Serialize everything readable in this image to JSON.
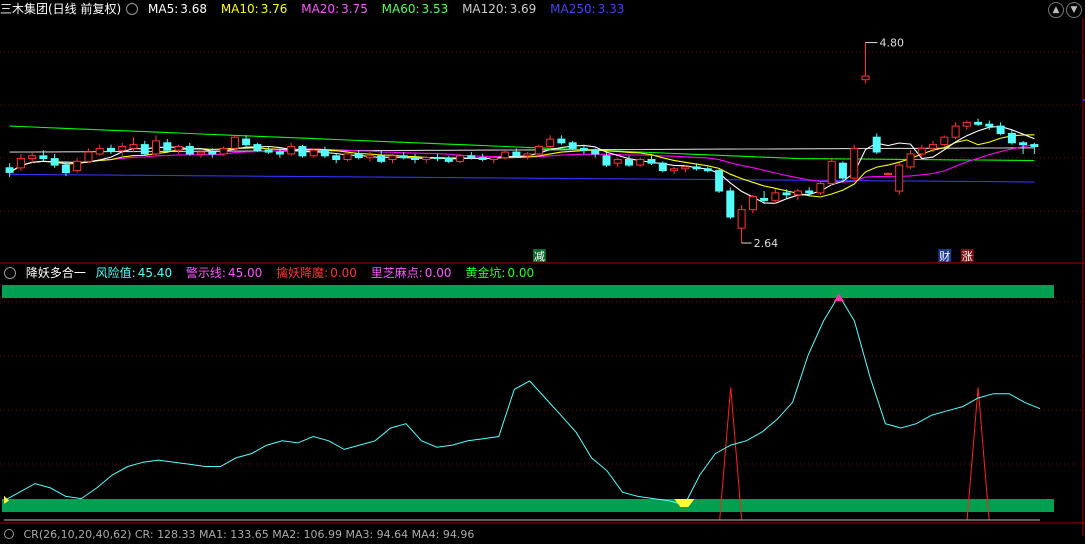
{
  "main_header": {
    "title": "三木集团(日线 前复权)",
    "items": [
      {
        "label": "MA5:",
        "value": "3.68",
        "color": "#ffffff"
      },
      {
        "label": "MA10:",
        "value": "3.76",
        "color": "#ffff00"
      },
      {
        "label": "MA20:",
        "value": "3.75",
        "color": "#ff00ff"
      },
      {
        "label": "MA60:",
        "value": "3.53",
        "color": "#00ff00"
      },
      {
        "label": "MA120:",
        "value": "3.69",
        "color": "#cccccc"
      },
      {
        "label": "MA250:",
        "value": "3.33",
        "color": "#3333ff"
      }
    ]
  },
  "indicator_header": {
    "title": "降妖多合一",
    "items": [
      {
        "label": "风险值:",
        "value": "45.40",
        "color": "#55ffff"
      },
      {
        "label": "警示线:",
        "value": "45.00",
        "color": "#ff55ff"
      },
      {
        "label": "擒妖降魔:",
        "value": "0.00",
        "color": "#ff3333"
      },
      {
        "label": "里芝麻点:",
        "value": "0.00",
        "color": "#ff55ff"
      },
      {
        "label": "黄金坑:",
        "value": "0.00",
        "color": "#00ff00"
      }
    ]
  },
  "bottom_header": {
    "text": "CR(26,10,20,40,62)  CR: 128.33  MA1: 133.65  MA2: 106.99  MA3: 94.64  MA4: 94.96"
  },
  "markers": {
    "high_label": "4.80",
    "low_label": "2.64",
    "tag_jian": "减",
    "tag_cai": "财",
    "tag_zhang": "涨"
  },
  "colors": {
    "up": "#ff3333",
    "down": "#54fcfc",
    "ma5": "#ffffff",
    "ma10": "#ffff00",
    "ma20": "#ff00ff",
    "ma60": "#00ff00",
    "ma120": "#cccccc",
    "ma250": "#3333ff",
    "band": "#00a050",
    "risk_line": "#55ffff",
    "signal": "#ff2020"
  },
  "chart_data": [
    {
      "type": "candlestick",
      "title": "三木集团(日线 前复权)",
      "ylim": [
        2.5,
        5.0
      ],
      "annotations": [
        {
          "text": "4.80",
          "y": 4.8
        },
        {
          "text": "2.64",
          "y": 2.64
        }
      ],
      "candles": [
        [
          3.45,
          3.5,
          3.35,
          3.4
        ],
        [
          3.45,
          3.6,
          3.42,
          3.55
        ],
        [
          3.55,
          3.62,
          3.5,
          3.58
        ],
        [
          3.58,
          3.64,
          3.52,
          3.55
        ],
        [
          3.55,
          3.6,
          3.45,
          3.48
        ],
        [
          3.48,
          3.52,
          3.36,
          3.4
        ],
        [
          3.42,
          3.55,
          3.4,
          3.52
        ],
        [
          3.52,
          3.66,
          3.5,
          3.62
        ],
        [
          3.6,
          3.7,
          3.58,
          3.66
        ],
        [
          3.66,
          3.7,
          3.6,
          3.63
        ],
        [
          3.64,
          3.72,
          3.58,
          3.68
        ],
        [
          3.66,
          3.78,
          3.62,
          3.7
        ],
        [
          3.7,
          3.74,
          3.58,
          3.6
        ],
        [
          3.6,
          3.8,
          3.58,
          3.74
        ],
        [
          3.72,
          3.76,
          3.62,
          3.64
        ],
        [
          3.64,
          3.7,
          3.6,
          3.68
        ],
        [
          3.68,
          3.72,
          3.58,
          3.6
        ],
        [
          3.6,
          3.64,
          3.56,
          3.62
        ],
        [
          3.62,
          3.66,
          3.56,
          3.6
        ],
        [
          3.6,
          3.68,
          3.58,
          3.66
        ],
        [
          3.66,
          3.8,
          3.64,
          3.78
        ],
        [
          3.76,
          3.8,
          3.66,
          3.7
        ],
        [
          3.7,
          3.72,
          3.62,
          3.64
        ],
        [
          3.64,
          3.68,
          3.6,
          3.62
        ],
        [
          3.62,
          3.66,
          3.56,
          3.6
        ],
        [
          3.6,
          3.72,
          3.58,
          3.68
        ],
        [
          3.68,
          3.7,
          3.56,
          3.58
        ],
        [
          3.58,
          3.66,
          3.56,
          3.64
        ],
        [
          3.64,
          3.68,
          3.56,
          3.58
        ],
        [
          3.58,
          3.6,
          3.5,
          3.54
        ],
        [
          3.54,
          3.62,
          3.52,
          3.6
        ],
        [
          3.6,
          3.64,
          3.54,
          3.56
        ],
        [
          3.56,
          3.62,
          3.52,
          3.58
        ],
        [
          3.58,
          3.64,
          3.5,
          3.52
        ],
        [
          3.54,
          3.6,
          3.5,
          3.58
        ],
        [
          3.58,
          3.62,
          3.54,
          3.56
        ],
        [
          3.56,
          3.6,
          3.5,
          3.54
        ],
        [
          3.54,
          3.58,
          3.5,
          3.56
        ],
        [
          3.56,
          3.6,
          3.52,
          3.55
        ],
        [
          3.55,
          3.58,
          3.5,
          3.52
        ],
        [
          3.52,
          3.6,
          3.5,
          3.58
        ],
        [
          3.58,
          3.62,
          3.54,
          3.56
        ],
        [
          3.56,
          3.6,
          3.52,
          3.54
        ],
        [
          3.54,
          3.58,
          3.5,
          3.56
        ],
        [
          3.56,
          3.64,
          3.54,
          3.62
        ],
        [
          3.62,
          3.66,
          3.56,
          3.58
        ],
        [
          3.58,
          3.62,
          3.54,
          3.6
        ],
        [
          3.6,
          3.7,
          3.58,
          3.68
        ],
        [
          3.68,
          3.8,
          3.64,
          3.76
        ],
        [
          3.76,
          3.8,
          3.7,
          3.72
        ],
        [
          3.72,
          3.74,
          3.64,
          3.66
        ],
        [
          3.66,
          3.7,
          3.6,
          3.64
        ],
        [
          3.64,
          3.66,
          3.56,
          3.6
        ],
        [
          3.58,
          3.62,
          3.46,
          3.48
        ],
        [
          3.5,
          3.56,
          3.46,
          3.54
        ],
        [
          3.54,
          3.58,
          3.46,
          3.48
        ],
        [
          3.48,
          3.56,
          3.46,
          3.54
        ],
        [
          3.54,
          3.58,
          3.48,
          3.5
        ],
        [
          3.5,
          3.52,
          3.4,
          3.42
        ],
        [
          3.42,
          3.46,
          3.38,
          3.44
        ],
        [
          3.44,
          3.48,
          3.4,
          3.46
        ],
        [
          3.46,
          3.5,
          3.42,
          3.44
        ],
        [
          3.44,
          3.46,
          3.4,
          3.42
        ],
        [
          3.42,
          3.44,
          3.18,
          3.2
        ],
        [
          3.2,
          3.24,
          2.9,
          2.92
        ],
        [
          2.8,
          3.05,
          2.64,
          3.0
        ],
        [
          3.0,
          3.16,
          2.96,
          3.14
        ],
        [
          3.12,
          3.2,
          3.06,
          3.1
        ],
        [
          3.1,
          3.22,
          3.06,
          3.18
        ],
        [
          3.18,
          3.22,
          3.12,
          3.16
        ],
        [
          3.16,
          3.22,
          3.1,
          3.2
        ],
        [
          3.2,
          3.24,
          3.14,
          3.18
        ],
        [
          3.18,
          3.3,
          3.16,
          3.28
        ],
        [
          3.28,
          3.56,
          3.26,
          3.52
        ],
        [
          3.5,
          3.52,
          3.3,
          3.34
        ],
        [
          3.34,
          3.7,
          3.32,
          3.66
        ],
        [
          4.4,
          4.8,
          4.36,
          4.44
        ],
        [
          3.78,
          3.82,
          3.6,
          3.62
        ],
        [
          3.38,
          3.4,
          3.38,
          3.39
        ],
        [
          3.2,
          3.5,
          3.16,
          3.48
        ],
        [
          3.46,
          3.64,
          3.44,
          3.6
        ],
        [
          3.6,
          3.7,
          3.56,
          3.66
        ],
        [
          3.66,
          3.74,
          3.62,
          3.7
        ],
        [
          3.7,
          3.8,
          3.68,
          3.78
        ],
        [
          3.78,
          3.94,
          3.76,
          3.9
        ],
        [
          3.9,
          3.96,
          3.86,
          3.94
        ],
        [
          3.94,
          3.98,
          3.9,
          3.92
        ],
        [
          3.92,
          3.96,
          3.86,
          3.9
        ],
        [
          3.9,
          3.94,
          3.8,
          3.82
        ],
        [
          3.82,
          3.86,
          3.7,
          3.72
        ],
        [
          3.72,
          3.74,
          3.6,
          3.7
        ],
        [
          3.7,
          3.72,
          3.6,
          3.68
        ]
      ],
      "series": [
        {
          "name": "MA5",
          "value": "3.68"
        },
        {
          "name": "MA10",
          "value": "3.76"
        },
        {
          "name": "MA20",
          "value": "3.75"
        },
        {
          "name": "MA60",
          "value": "3.53"
        },
        {
          "name": "MA120",
          "value": "3.69"
        },
        {
          "name": "MA250",
          "value": "3.33"
        }
      ]
    },
    {
      "type": "line",
      "title": "降妖多合一",
      "ylim": [
        0,
        100
      ],
      "series": [
        {
          "name": "风险值",
          "values": [
            2,
            6,
            10,
            8,
            4,
            3,
            8,
            14,
            18,
            20,
            21,
            20,
            19,
            18,
            18,
            22,
            24,
            28,
            30,
            29,
            32,
            30,
            26,
            28,
            30,
            36,
            38,
            30,
            27,
            28,
            30,
            31,
            32,
            54,
            58,
            50,
            42,
            34,
            22,
            16,
            6,
            4,
            3,
            2,
            0,
            14,
            24,
            28,
            30,
            34,
            40,
            48,
            70,
            86,
            98,
            86,
            60,
            38,
            36,
            38,
            42,
            44,
            46,
            50,
            52,
            52,
            48,
            45
          ]
        },
        {
          "name": "擒妖降魔",
          "values": [
            0,
            0,
            0,
            0,
            0,
            0,
            0,
            0,
            0,
            0,
            0,
            0,
            0,
            0,
            0,
            0,
            0,
            0,
            0,
            0,
            0,
            0,
            0,
            0,
            0,
            0,
            0,
            0,
            0,
            0,
            0,
            0,
            0,
            0,
            0,
            0,
            0,
            0,
            0,
            0,
            0,
            0,
            0,
            0,
            0,
            0,
            0,
            35,
            0,
            0,
            0,
            0,
            0,
            0,
            0,
            0,
            0,
            0,
            0,
            0,
            0,
            0,
            0,
            35,
            0,
            0,
            0,
            0
          ]
        }
      ]
    }
  ]
}
